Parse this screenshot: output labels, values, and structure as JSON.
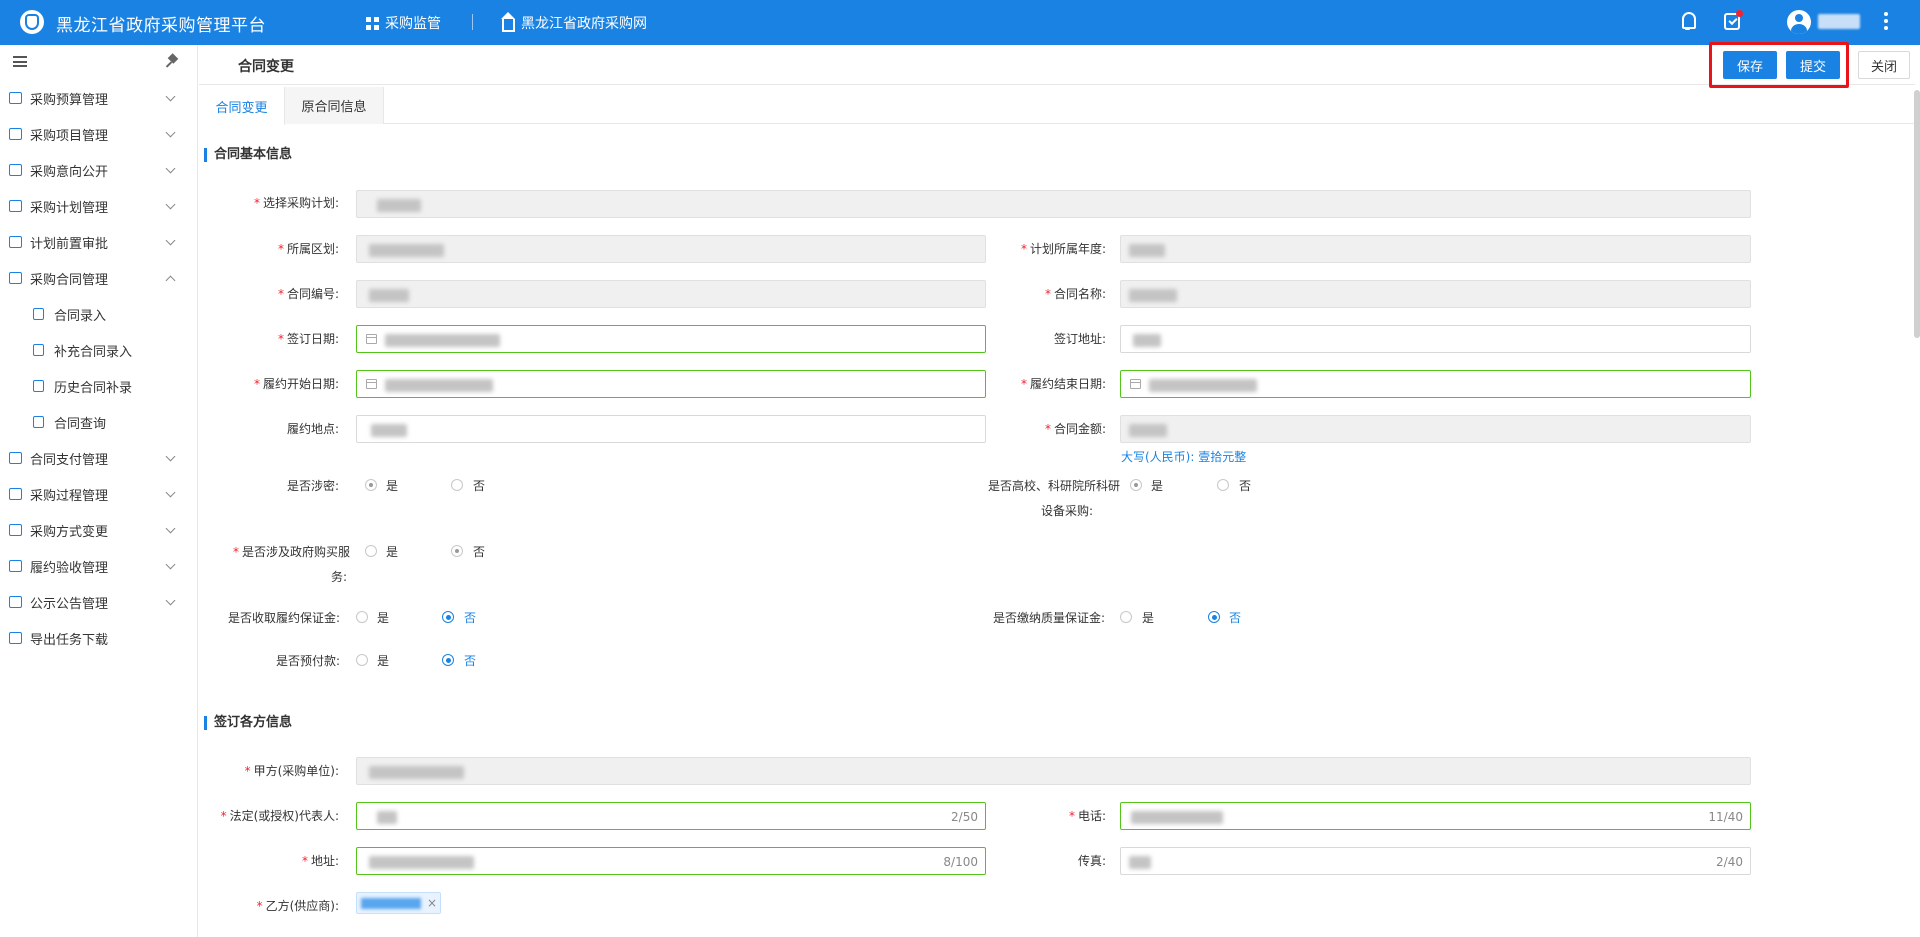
{
  "header": {
    "app_title": "黑龙江省政府采购管理平台",
    "nav": [
      {
        "label": "采购监管",
        "icon": "grid-icon"
      },
      {
        "label": "黑龙江省政府采购网",
        "icon": "home-icon"
      }
    ],
    "icons": [
      "bell-icon",
      "task-check-icon",
      "avatar-icon",
      "more-vertical-icon"
    ]
  },
  "sidebar": {
    "items": [
      {
        "label": "采购预算管理",
        "expandable": true
      },
      {
        "label": "采购项目管理",
        "expandable": true
      },
      {
        "label": "采购意向公开",
        "expandable": true
      },
      {
        "label": "采购计划管理",
        "expandable": true
      },
      {
        "label": "计划前置审批",
        "expandable": true
      },
      {
        "label": "采购合同管理",
        "expandable": true,
        "expanded": true
      },
      {
        "label": "合同录入",
        "sub": true
      },
      {
        "label": "补充合同录入",
        "sub": true
      },
      {
        "label": "历史合同补录",
        "sub": true
      },
      {
        "label": "合同查询",
        "sub": true
      },
      {
        "label": "合同支付管理",
        "expandable": true
      },
      {
        "label": "采购过程管理",
        "expandable": true
      },
      {
        "label": "采购方式变更",
        "expandable": true
      },
      {
        "label": "履约验收管理",
        "expandable": true
      },
      {
        "label": "公示公告管理",
        "expandable": true
      },
      {
        "label": "导出任务下载",
        "expandable": false
      }
    ]
  },
  "page": {
    "title": "合同变更",
    "buttons": {
      "save": "保存",
      "submit": "提交",
      "close": "关闭"
    },
    "tabs": [
      "合同变更",
      "原合同信息"
    ]
  },
  "basic": {
    "section_title": "合同基本信息",
    "labels": {
      "plan": "选择采购计划:",
      "region": "所属区划:",
      "year": "计划所属年度:",
      "contract_no": "合同编号:",
      "contract_name": "合同名称:",
      "sign_date": "签订日期:",
      "sign_address": "签订地址:",
      "start_date": "履约开始日期:",
      "end_date": "履约结束日期:",
      "perform_place": "履约地点:",
      "amount": "合同金额:",
      "secret": "是否涉密:",
      "univ_1": "是否高校、科研院所科研",
      "univ_2": "设备采购:",
      "gov_service_1": "是否涉及政府购买服",
      "gov_service_2": "务:",
      "perf_bond": "是否收取履约保证金:",
      "quality_bond": "是否缴纳质量保证金:",
      "prepay": "是否预付款:"
    },
    "amount_caption": "大写(人民币): 壹拾元整",
    "yes": "是",
    "no": "否"
  },
  "parties": {
    "section_title": "签订各方信息",
    "labels": {
      "party_a": "甲方(采购单位):",
      "legal_rep": "法定(或授权)代表人:",
      "phone": "电话:",
      "address": "地址:",
      "fax": "传真:",
      "party_b": "乙方(供应商):"
    },
    "counters": {
      "legal_rep": "2/50",
      "phone": "11/40",
      "address": "8/100",
      "fax": "2/40"
    },
    "tag_close": "×"
  }
}
